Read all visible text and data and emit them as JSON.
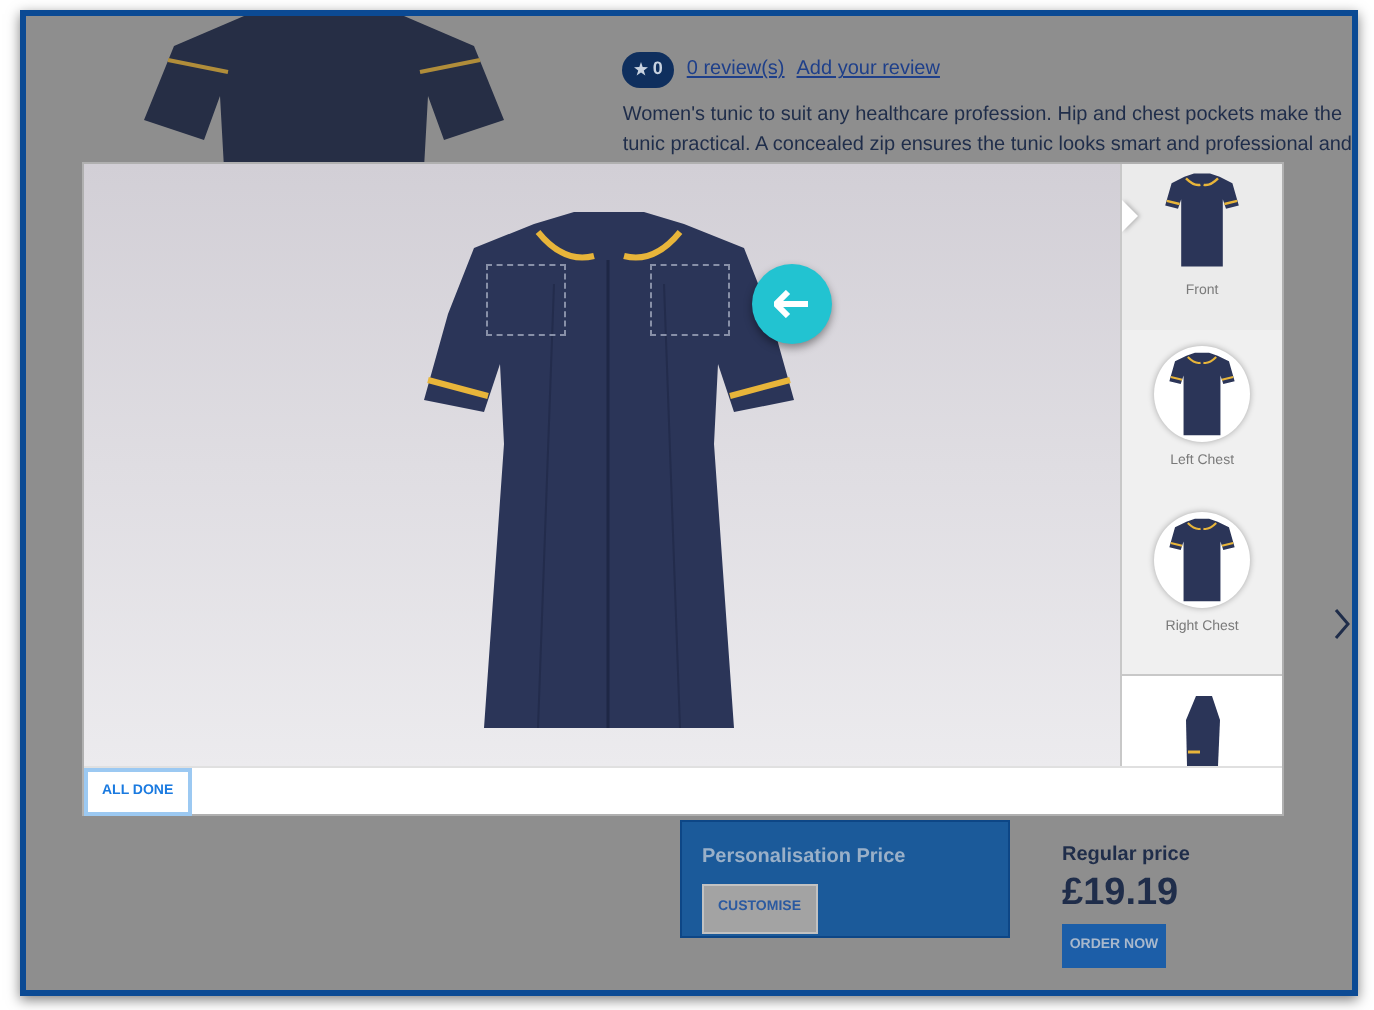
{
  "page": {
    "rating": "0",
    "reviews_link": "0 review(s)",
    "add_review_link": "Add your review",
    "description_lines": [
      "Women's tunic to suit any healthcare profession. Hip and chest pockets make the",
      "tunic practical. A concealed zip ensures the tunic looks smart and professional and"
    ],
    "personalisation": {
      "title": "Personalisation Price",
      "button": "CUSTOMISE"
    },
    "regular": {
      "title": "Regular price",
      "price": "£19.19",
      "button": "ORDER NOW"
    }
  },
  "modal": {
    "thumbnails": [
      {
        "kind": "full",
        "label": "Front",
        "selected": true
      },
      {
        "kind": "circle",
        "label": "Left Chest",
        "selected": false
      },
      {
        "kind": "circle",
        "label": "Right Chest",
        "selected": false
      },
      {
        "kind": "side",
        "selected": false
      }
    ],
    "done_button": "ALL DONE"
  }
}
